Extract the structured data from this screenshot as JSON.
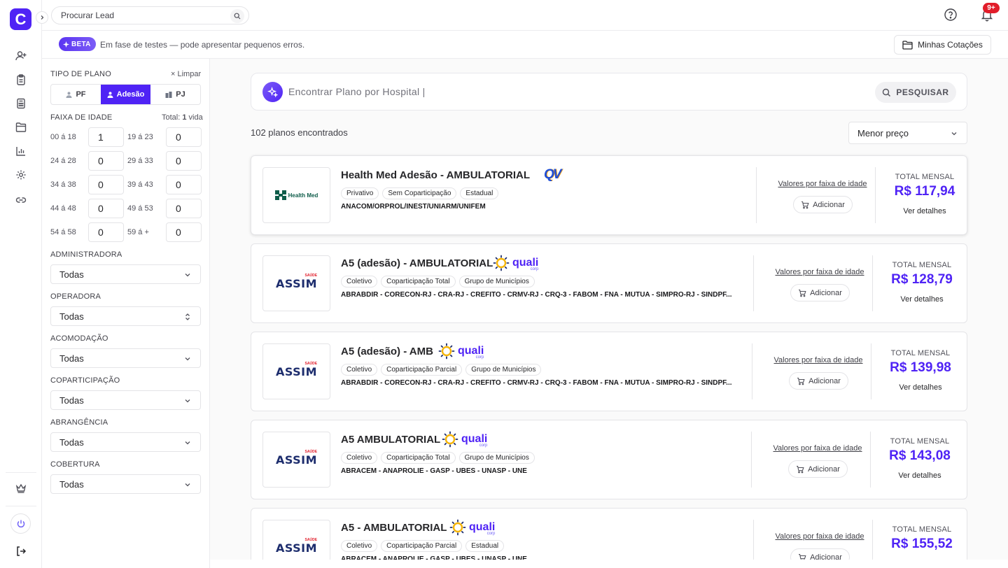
{
  "topbar": {
    "lead_search_placeholder": "Procurar Lead",
    "notification_badge": "9+"
  },
  "beta": {
    "badge": "BETA",
    "text": "Em fase de testes — pode apresentar pequenos erros.",
    "cotacoes_button": "Minhas Cotações"
  },
  "filters": {
    "plan_type_label": "TIPO DE PLANO",
    "clear_label": "Limpar",
    "plan_types": [
      "PF",
      "Adesão",
      "PJ"
    ],
    "selected_plan_type": "Adesão",
    "age_label": "FAIXA DE IDADE",
    "total_prefix": "Total:",
    "total_count": "1",
    "total_suffix": "vida",
    "ages": [
      {
        "label": "00 á 18",
        "value": "1"
      },
      {
        "label": "19 á 23",
        "value": "0"
      },
      {
        "label": "24 á 28",
        "value": "0"
      },
      {
        "label": "29 á 33",
        "value": "0"
      },
      {
        "label": "34 á 38",
        "value": "0"
      },
      {
        "label": "39 á 43",
        "value": "0"
      },
      {
        "label": "44 á 48",
        "value": "0"
      },
      {
        "label": "49 á 53",
        "value": "0"
      },
      {
        "label": "54 á 58",
        "value": "0"
      },
      {
        "label": "59 á +",
        "value": "0"
      }
    ],
    "selects": [
      {
        "label": "ADMINISTRADORA",
        "value": "Todas"
      },
      {
        "label": "OPERADORA",
        "value": "Todas"
      },
      {
        "label": "ACOMODAÇÃO",
        "value": "Todas"
      },
      {
        "label": "COPARTICIPAÇÃO",
        "value": "Todas"
      },
      {
        "label": "ABRANGÊNCIA",
        "value": "Todas"
      },
      {
        "label": "COBERTURA",
        "value": "Todas"
      }
    ]
  },
  "main": {
    "hospital_search_placeholder": "Encontrar Plano por Hospital |",
    "search_button": "PESQUISAR",
    "results_count": "102 planos encontrados",
    "sort_value": "Menor preço",
    "faixa_link": "Valores por faixa de idade",
    "add_label": "Adicionar",
    "total_label": "TOTAL MENSAL",
    "details_label": "Ver detalhes"
  },
  "plans": [
    {
      "title": "Health Med Adesão - AMBULATORIAL",
      "logo_text": "Health Med",
      "operator": "QV",
      "tags": [
        "Privativo",
        "Sem Coparticipação",
        "Estadual"
      ],
      "entities": "ANACOM/ORPROL/INEST/UNIARM/UNIFEM",
      "price": "R$ 117,94"
    },
    {
      "title": "A5 (adesão) - AMBULATORIAL",
      "logo_text": "ASSIM",
      "logo_sup": "SAÚDE",
      "operator": "quali",
      "operator_sub": "corp",
      "tags": [
        "Coletivo",
        "Coparticipação Total",
        "Grupo de Municípios"
      ],
      "entities": "ABRABDIR - CORECON-RJ - CRA-RJ - CREFITO - CRMV-RJ - CRQ-3 - FABOM - FNA - MÚTUA - SIMPRO-RJ - SINDPF...",
      "price": "R$ 128,79"
    },
    {
      "title": "A5 (adesão) - AMB",
      "logo_text": "ASSIM",
      "logo_sup": "SAÚDE",
      "operator": "quali",
      "operator_sub": "corp",
      "tags": [
        "Coletivo",
        "Coparticipação Parcial",
        "Grupo de Municípios"
      ],
      "entities": "ABRABDIR - CORECON-RJ - CRA-RJ - CREFITO - CRMV-RJ - CRQ-3 - FABOM - FNA - MÚTUA - SIMPRO-RJ - SINDPF...",
      "price": "R$ 139,98"
    },
    {
      "title": "A5 AMBULATORIAL",
      "logo_text": "ASSIM",
      "logo_sup": "SAÚDE",
      "operator": "quali",
      "operator_sub": "corp",
      "tags": [
        "Coletivo",
        "Coparticipação Total",
        "Grupo de Municípios"
      ],
      "entities": "ABRACEM - ANAPROLIE - GASP - UBES - UNASP - UNE",
      "price": "R$ 143,08"
    },
    {
      "title": "A5 - AMBULATORIAL",
      "logo_text": "ASSIM",
      "logo_sup": "SAÚDE",
      "operator": "quali",
      "operator_sub": "corp",
      "tags": [
        "Coletivo",
        "Coparticipação Parcial",
        "Estadual"
      ],
      "entities": "ABRACEM - ANAPROLIE - GASP - UBES - UNASP - UNE",
      "price": "R$ 155,52"
    }
  ],
  "colors": {
    "brand": "#4f23f5",
    "badge": "#e11d2a"
  }
}
